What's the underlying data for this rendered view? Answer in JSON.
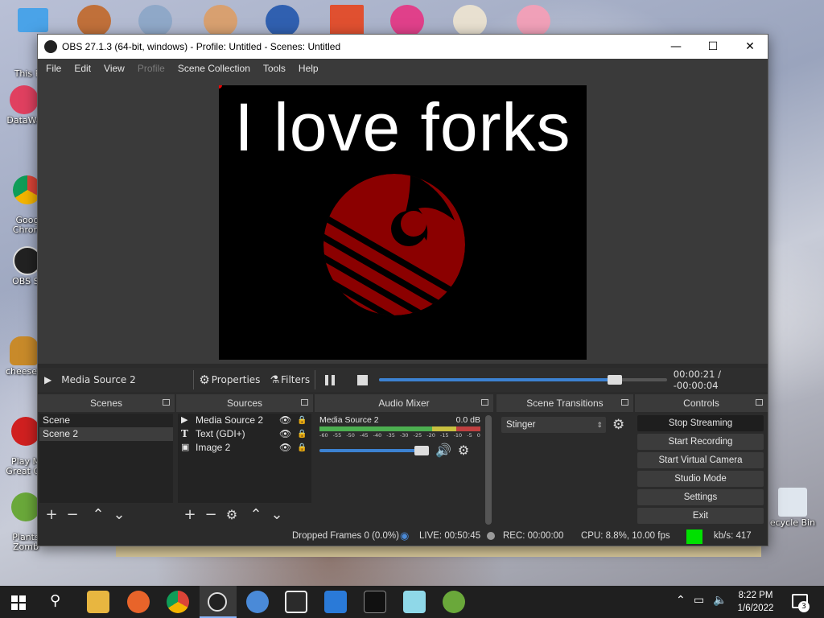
{
  "desktop": {
    "icons": [
      {
        "label": "This P",
        "color": "#3d8ee0"
      },
      {
        "label": "DataWa",
        "color": "#e04060"
      },
      {
        "label": "Goog\nChrom",
        "color": "#3c8d3a"
      },
      {
        "label": "OBS St",
        "color": "#222222"
      },
      {
        "label": "cheeseb",
        "color": "#c88a2a"
      },
      {
        "label": "Play M\nGreat Ga",
        "color": "#d02020"
      },
      {
        "label": "Plants\nZomb",
        "color": "#6aa83a"
      }
    ],
    "recycle_label": "ecycle Bin"
  },
  "window": {
    "title": "OBS 27.1.3 (64-bit, windows) - Profile: Untitled - Scenes: Untitled",
    "minimize": "—",
    "maximize": "☐",
    "close": "✕"
  },
  "menu": [
    {
      "label": "File",
      "enabled": true
    },
    {
      "label": "Edit",
      "enabled": true
    },
    {
      "label": "View",
      "enabled": true
    },
    {
      "label": "Profile",
      "enabled": false
    },
    {
      "label": "Scene Collection",
      "enabled": true
    },
    {
      "label": "Tools",
      "enabled": true
    },
    {
      "label": "Help",
      "enabled": true
    }
  ],
  "preview": {
    "text": "I love forks",
    "logo_color": "#8b0000"
  },
  "media": {
    "source_name": "Media Source 2",
    "properties_label": "Properties",
    "filters_label": "Filters",
    "time": "00:00:21 / -00:00:04",
    "progress": 0.81
  },
  "scenes": {
    "title": "Scenes",
    "items": [
      {
        "label": "Scene",
        "selected": false
      },
      {
        "label": "Scene 2",
        "selected": true
      }
    ]
  },
  "sources": {
    "title": "Sources",
    "items": [
      {
        "label": "Media Source 2",
        "icon": "play-icon"
      },
      {
        "label": "Text (GDI+)",
        "icon": "text-icon"
      },
      {
        "label": "Image 2",
        "icon": "image-icon"
      }
    ]
  },
  "mixer": {
    "title": "Audio Mixer",
    "channel": "Media Source 2",
    "level": "0.0 dB",
    "scale": [
      "-60",
      "-55",
      "-50",
      "-45",
      "-40",
      "-35",
      "-30",
      "-25",
      "-20",
      "-15",
      "-10",
      "-5",
      "0"
    ],
    "volume": 1.0
  },
  "transitions": {
    "title": "Scene Transitions",
    "selected": "Stinger"
  },
  "controls": {
    "title": "Controls",
    "buttons": [
      {
        "label": "Stop Streaming",
        "active": true
      },
      {
        "label": "Start Recording",
        "active": false
      },
      {
        "label": "Start Virtual Camera",
        "active": false
      },
      {
        "label": "Studio Mode",
        "active": false
      },
      {
        "label": "Settings",
        "active": false
      },
      {
        "label": "Exit",
        "active": false
      }
    ]
  },
  "status": {
    "dropped": "Dropped Frames 0 (0.0%)",
    "live": "LIVE: 00:50:45",
    "rec": "REC: 00:00:00",
    "cpu": "CPU: 8.8%, 10.00 fps",
    "kbs": "kb/s: 417",
    "health_color": "#00e000"
  },
  "taskbar": {
    "time": "8:22 PM",
    "date": "1/6/2022",
    "notifications": "3"
  }
}
